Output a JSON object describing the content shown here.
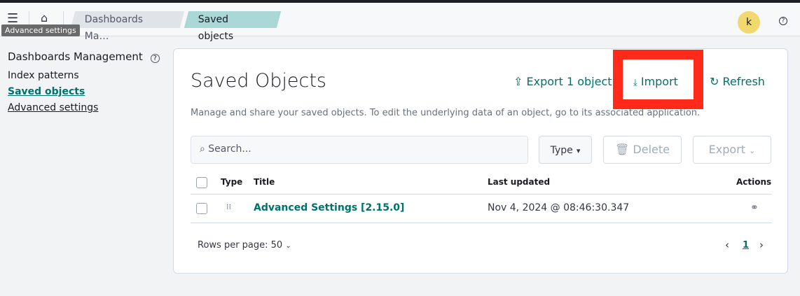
{
  "header": {
    "tooltip": "Advanced settings",
    "breadcrumbs": [
      "Dashboards Ma…",
      "Saved objects"
    ],
    "avatar": "k",
    "help": "?"
  },
  "sidebar": {
    "title": "Dashboards Management",
    "help": "?",
    "items": [
      {
        "label": "Index patterns"
      },
      {
        "label": "Saved objects"
      },
      {
        "label": "Advanced settings"
      }
    ]
  },
  "main": {
    "title": "Saved Objects",
    "export_label": "Export 1 object",
    "import_label": "Import",
    "refresh_label": "Refresh",
    "description": "Manage and share your saved objects. To edit the underlying data of an object, go to its associated application.",
    "search_placeholder": "Search...",
    "type_label": "Type",
    "delete_label": "Delete",
    "export_menu_label": "Export",
    "columns": [
      "Type",
      "Title",
      "Last updated",
      "Actions"
    ],
    "rows": [
      {
        "title": "Advanced Settings [2.15.0]",
        "last_updated": "Nov 4, 2024 @ 08:46:30.347"
      }
    ],
    "rows_per_page": "Rows per page: 50",
    "page": "1"
  },
  "colors": {
    "accent": "#00726b",
    "highlight": "#ff2a1a"
  }
}
